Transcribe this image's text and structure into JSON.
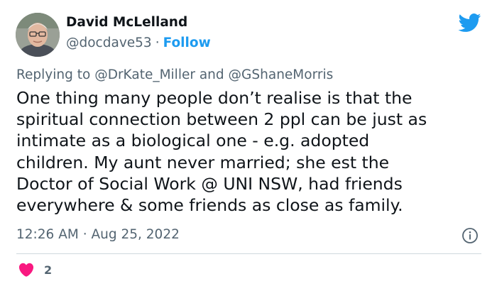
{
  "author": {
    "name": "David McLelland",
    "handle": "@docdave53",
    "separator": "·",
    "follow_label": "Follow",
    "avatar": "avatar-photo"
  },
  "reply_context": {
    "prefix": "Replying to",
    "mention_1": "@DrKate_Miller",
    "conjunction": "and",
    "mention_2": "@GShaneMorris"
  },
  "tweet": {
    "lines": [
      "One thing many people don’t realise is that the",
      "spiritual connection between 2 ppl can be just as",
      "intimate as a biological one - e.g. adopted",
      "children. My aunt never married; she est the",
      "Doctor of Social Work @ UNI NSW, had friends",
      "everywhere & some friends as close as family."
    ]
  },
  "meta": {
    "time": "12:26 AM",
    "separator": "·",
    "date": "Aug 25, 2022"
  },
  "actions": {
    "like_count": "2"
  },
  "icons": {
    "brand": "twitter-bird-icon",
    "info": "info-icon",
    "like": "heart-icon"
  },
  "colors": {
    "accent": "#1d9bf0",
    "text_primary": "#0f1419",
    "text_secondary": "#536471",
    "like": "#f91880",
    "divider": "#cfd9de"
  }
}
